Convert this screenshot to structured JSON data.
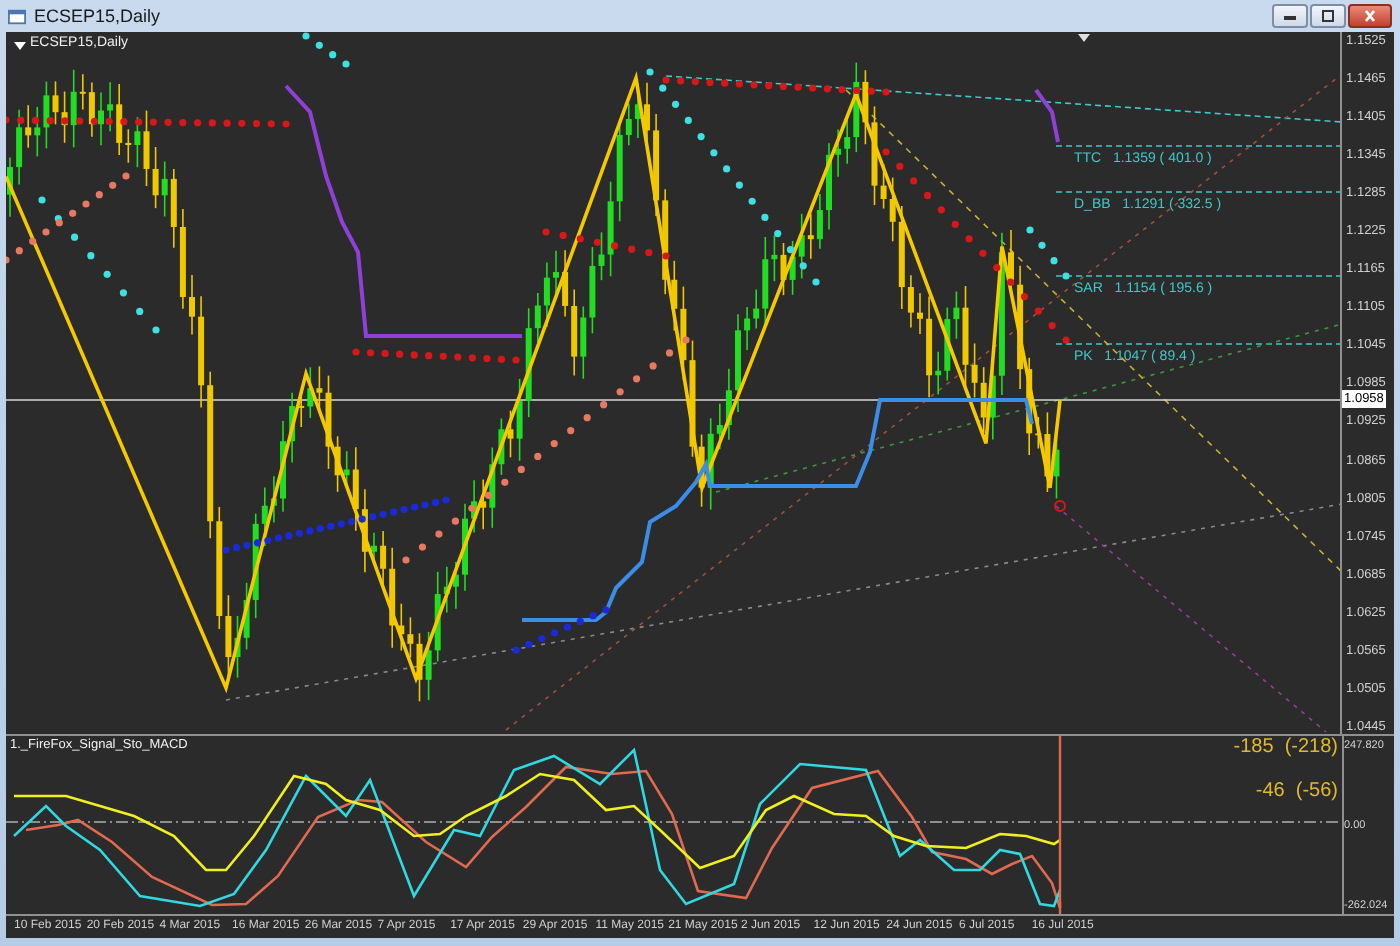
{
  "window": {
    "title": "ECSEP15,Daily"
  },
  "chart": {
    "label": "ECSEP15,Daily",
    "price_axis": [
      "1.1525",
      "1.1465",
      "1.1405",
      "1.1345",
      "1.1285",
      "1.1225",
      "1.1165",
      "1.1105",
      "1.1045",
      "1.0985",
      "1.0925",
      "1.0865",
      "1.0805",
      "1.0745",
      "1.0685",
      "1.0625",
      "1.0565",
      "1.0505",
      "1.0445"
    ],
    "current_price": "1.0958",
    "level_labels": [
      {
        "text": "TTC   1.1359 ( 401.0 )"
      },
      {
        "text": "D_BB   1.1291 ( 332.5 )"
      },
      {
        "text": "SAR   1.1154 ( 195.6 )"
      },
      {
        "text": "PK   1.1047 ( 89.4 )"
      }
    ]
  },
  "indicator": {
    "label": "1._FireFox_Signal_Sto_MACD",
    "values": [
      "-185  (-218)",
      "-46  (-56)"
    ],
    "axis": [
      "247.820",
      "0.00",
      "-262.024"
    ]
  },
  "date_axis": [
    "10 Feb 2015",
    "20 Feb 2015",
    "4 Mar 2015",
    "16 Mar 2015",
    "26 Mar 2015",
    "7 Apr 2015",
    "17 Apr 2015",
    "29 Apr 2015",
    "11 May 2015",
    "21 May 2015",
    "2 Jun 2015",
    "12 Jun 2015",
    "24 Jun 2015",
    "6 Jul 2015",
    "16 Jul 2015"
  ]
}
